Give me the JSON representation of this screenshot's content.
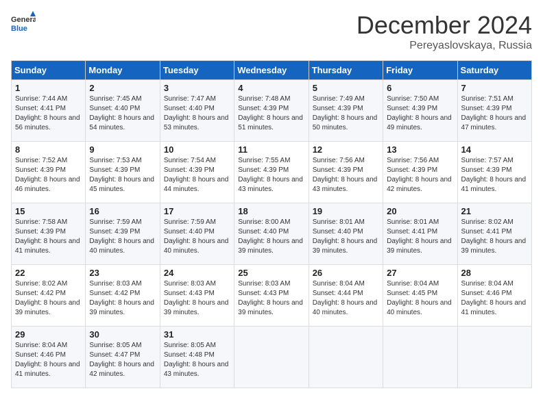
{
  "header": {
    "logo": {
      "general": "General",
      "blue": "Blue"
    },
    "title": "December 2024",
    "location": "Pereyaslovskaya, Russia"
  },
  "weekdays": [
    "Sunday",
    "Monday",
    "Tuesday",
    "Wednesday",
    "Thursday",
    "Friday",
    "Saturday"
  ],
  "weeks": [
    [
      {
        "day": "1",
        "sunrise": "Sunrise: 7:44 AM",
        "sunset": "Sunset: 4:41 PM",
        "daylight": "Daylight: 8 hours and 56 minutes."
      },
      {
        "day": "2",
        "sunrise": "Sunrise: 7:45 AM",
        "sunset": "Sunset: 4:40 PM",
        "daylight": "Daylight: 8 hours and 54 minutes."
      },
      {
        "day": "3",
        "sunrise": "Sunrise: 7:47 AM",
        "sunset": "Sunset: 4:40 PM",
        "daylight": "Daylight: 8 hours and 53 minutes."
      },
      {
        "day": "4",
        "sunrise": "Sunrise: 7:48 AM",
        "sunset": "Sunset: 4:39 PM",
        "daylight": "Daylight: 8 hours and 51 minutes."
      },
      {
        "day": "5",
        "sunrise": "Sunrise: 7:49 AM",
        "sunset": "Sunset: 4:39 PM",
        "daylight": "Daylight: 8 hours and 50 minutes."
      },
      {
        "day": "6",
        "sunrise": "Sunrise: 7:50 AM",
        "sunset": "Sunset: 4:39 PM",
        "daylight": "Daylight: 8 hours and 49 minutes."
      },
      {
        "day": "7",
        "sunrise": "Sunrise: 7:51 AM",
        "sunset": "Sunset: 4:39 PM",
        "daylight": "Daylight: 8 hours and 47 minutes."
      }
    ],
    [
      {
        "day": "8",
        "sunrise": "Sunrise: 7:52 AM",
        "sunset": "Sunset: 4:39 PM",
        "daylight": "Daylight: 8 hours and 46 minutes."
      },
      {
        "day": "9",
        "sunrise": "Sunrise: 7:53 AM",
        "sunset": "Sunset: 4:39 PM",
        "daylight": "Daylight: 8 hours and 45 minutes."
      },
      {
        "day": "10",
        "sunrise": "Sunrise: 7:54 AM",
        "sunset": "Sunset: 4:39 PM",
        "daylight": "Daylight: 8 hours and 44 minutes."
      },
      {
        "day": "11",
        "sunrise": "Sunrise: 7:55 AM",
        "sunset": "Sunset: 4:39 PM",
        "daylight": "Daylight: 8 hours and 43 minutes."
      },
      {
        "day": "12",
        "sunrise": "Sunrise: 7:56 AM",
        "sunset": "Sunset: 4:39 PM",
        "daylight": "Daylight: 8 hours and 43 minutes."
      },
      {
        "day": "13",
        "sunrise": "Sunrise: 7:56 AM",
        "sunset": "Sunset: 4:39 PM",
        "daylight": "Daylight: 8 hours and 42 minutes."
      },
      {
        "day": "14",
        "sunrise": "Sunrise: 7:57 AM",
        "sunset": "Sunset: 4:39 PM",
        "daylight": "Daylight: 8 hours and 41 minutes."
      }
    ],
    [
      {
        "day": "15",
        "sunrise": "Sunrise: 7:58 AM",
        "sunset": "Sunset: 4:39 PM",
        "daylight": "Daylight: 8 hours and 41 minutes."
      },
      {
        "day": "16",
        "sunrise": "Sunrise: 7:59 AM",
        "sunset": "Sunset: 4:39 PM",
        "daylight": "Daylight: 8 hours and 40 minutes."
      },
      {
        "day": "17",
        "sunrise": "Sunrise: 7:59 AM",
        "sunset": "Sunset: 4:40 PM",
        "daylight": "Daylight: 8 hours and 40 minutes."
      },
      {
        "day": "18",
        "sunrise": "Sunrise: 8:00 AM",
        "sunset": "Sunset: 4:40 PM",
        "daylight": "Daylight: 8 hours and 39 minutes."
      },
      {
        "day": "19",
        "sunrise": "Sunrise: 8:01 AM",
        "sunset": "Sunset: 4:40 PM",
        "daylight": "Daylight: 8 hours and 39 minutes."
      },
      {
        "day": "20",
        "sunrise": "Sunrise: 8:01 AM",
        "sunset": "Sunset: 4:41 PM",
        "daylight": "Daylight: 8 hours and 39 minutes."
      },
      {
        "day": "21",
        "sunrise": "Sunrise: 8:02 AM",
        "sunset": "Sunset: 4:41 PM",
        "daylight": "Daylight: 8 hours and 39 minutes."
      }
    ],
    [
      {
        "day": "22",
        "sunrise": "Sunrise: 8:02 AM",
        "sunset": "Sunset: 4:42 PM",
        "daylight": "Daylight: 8 hours and 39 minutes."
      },
      {
        "day": "23",
        "sunrise": "Sunrise: 8:03 AM",
        "sunset": "Sunset: 4:42 PM",
        "daylight": "Daylight: 8 hours and 39 minutes."
      },
      {
        "day": "24",
        "sunrise": "Sunrise: 8:03 AM",
        "sunset": "Sunset: 4:43 PM",
        "daylight": "Daylight: 8 hours and 39 minutes."
      },
      {
        "day": "25",
        "sunrise": "Sunrise: 8:03 AM",
        "sunset": "Sunset: 4:43 PM",
        "daylight": "Daylight: 8 hours and 39 minutes."
      },
      {
        "day": "26",
        "sunrise": "Sunrise: 8:04 AM",
        "sunset": "Sunset: 4:44 PM",
        "daylight": "Daylight: 8 hours and 40 minutes."
      },
      {
        "day": "27",
        "sunrise": "Sunrise: 8:04 AM",
        "sunset": "Sunset: 4:45 PM",
        "daylight": "Daylight: 8 hours and 40 minutes."
      },
      {
        "day": "28",
        "sunrise": "Sunrise: 8:04 AM",
        "sunset": "Sunset: 4:46 PM",
        "daylight": "Daylight: 8 hours and 41 minutes."
      }
    ],
    [
      {
        "day": "29",
        "sunrise": "Sunrise: 8:04 AM",
        "sunset": "Sunset: 4:46 PM",
        "daylight": "Daylight: 8 hours and 41 minutes."
      },
      {
        "day": "30",
        "sunrise": "Sunrise: 8:05 AM",
        "sunset": "Sunset: 4:47 PM",
        "daylight": "Daylight: 8 hours and 42 minutes."
      },
      {
        "day": "31",
        "sunrise": "Sunrise: 8:05 AM",
        "sunset": "Sunset: 4:48 PM",
        "daylight": "Daylight: 8 hours and 43 minutes."
      },
      null,
      null,
      null,
      null
    ]
  ]
}
